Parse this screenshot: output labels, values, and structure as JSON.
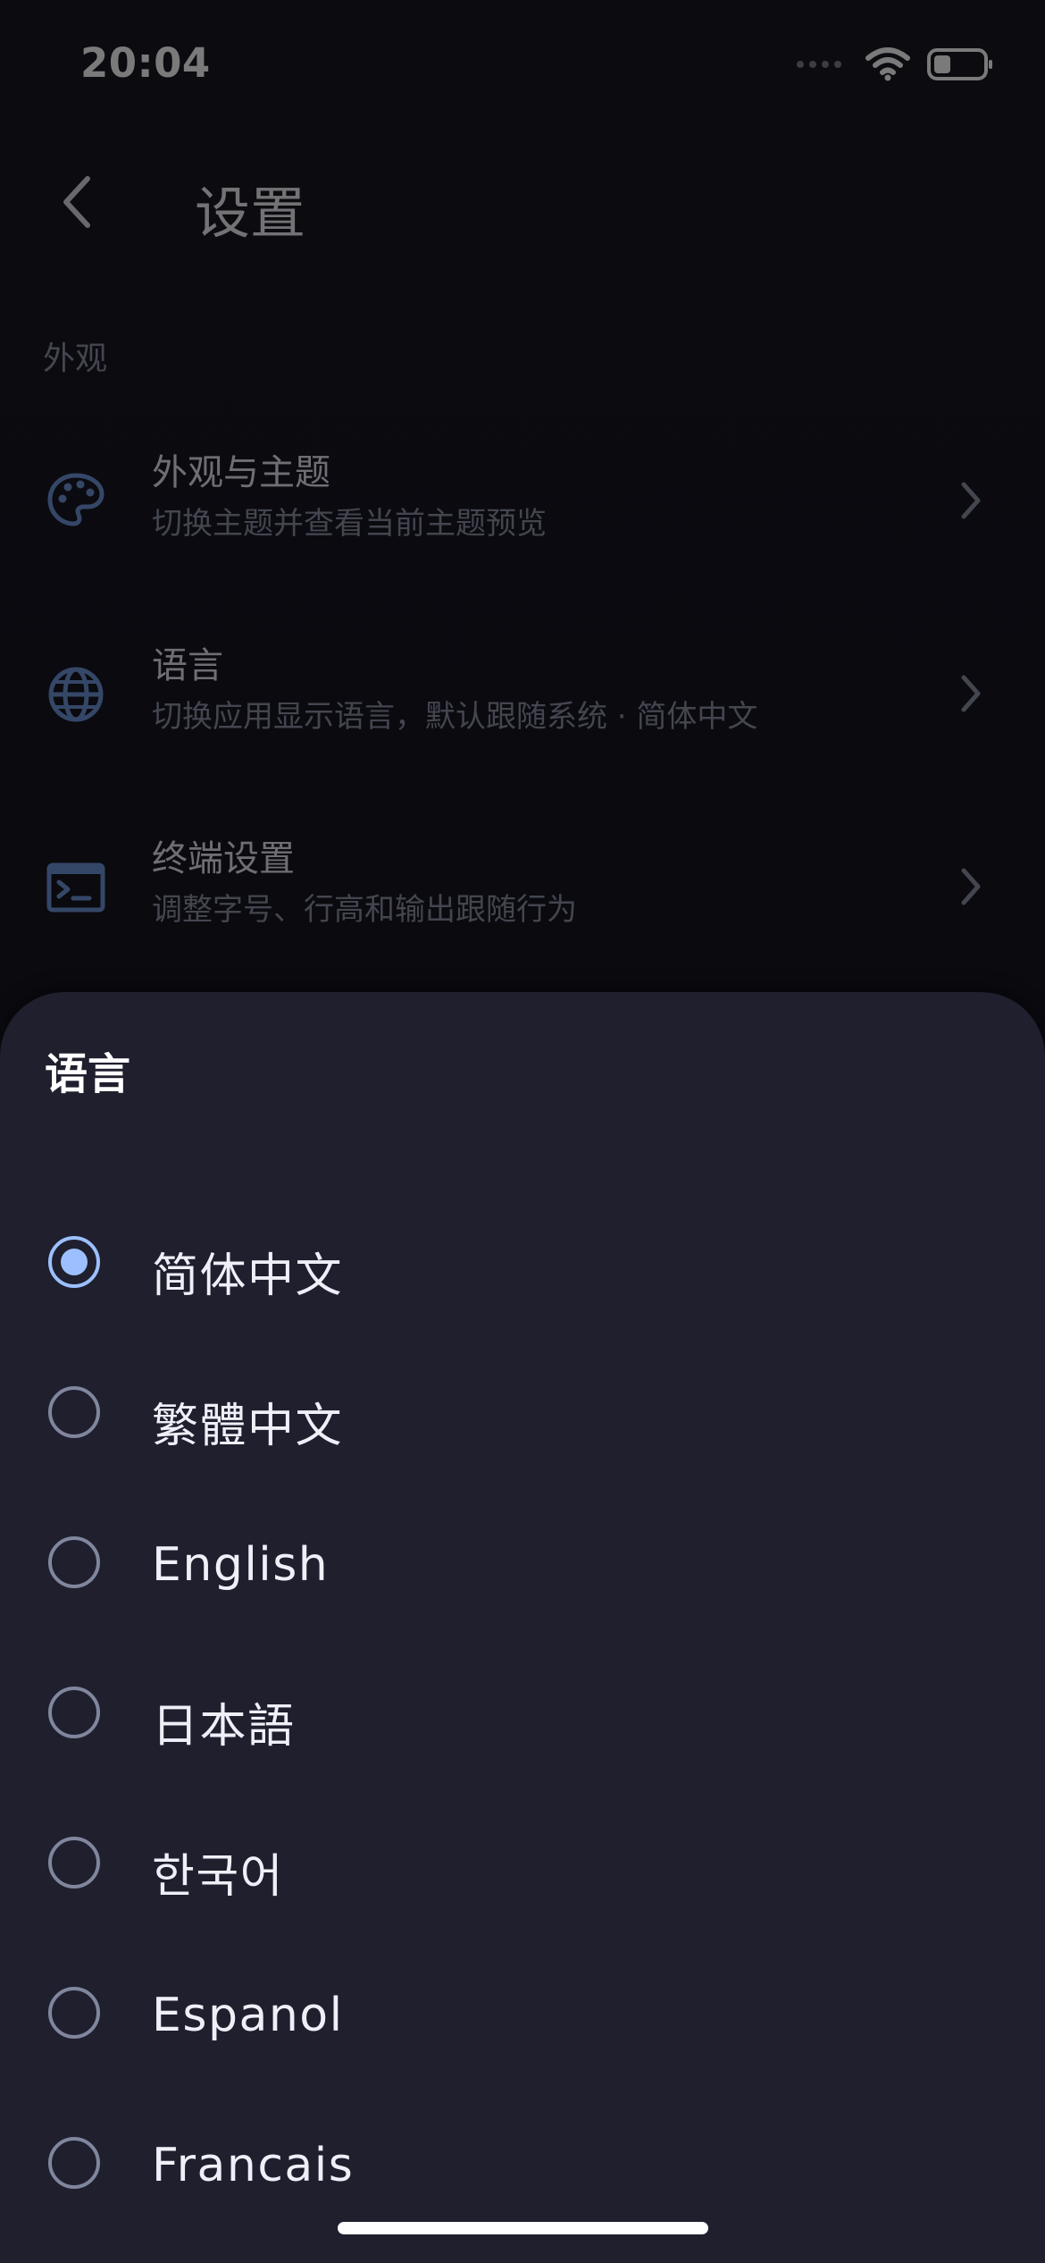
{
  "status_bar": {
    "time": "20:04",
    "icons": [
      "signal-dots-icon",
      "wifi-icon",
      "battery-icon"
    ]
  },
  "header": {
    "title": "设置",
    "back_icon": "chevron-left-icon"
  },
  "section": {
    "label": "外观"
  },
  "settings": [
    {
      "title": "外观与主题",
      "subtitle": "切换主题并查看当前主题预览",
      "icon": "palette-icon"
    },
    {
      "title": "语言",
      "subtitle": "切换应用显示语言，默认跟随系统 · 简体中文",
      "icon": "globe-icon"
    },
    {
      "title": "终端设置",
      "subtitle": "调整字号、行高和输出跟随行为",
      "icon": "terminal-icon"
    }
  ],
  "sheet": {
    "title": "语言",
    "options": [
      {
        "label": "简体中文",
        "selected": true
      },
      {
        "label": "繁體中文",
        "selected": false
      },
      {
        "label": "English",
        "selected": false
      },
      {
        "label": "日本語",
        "selected": false
      },
      {
        "label": "한국어",
        "selected": false
      },
      {
        "label": "Espanol",
        "selected": false
      },
      {
        "label": "Francais",
        "selected": false
      }
    ]
  },
  "colors": {
    "accent": "#9cc0ff",
    "sheet_bg": "#1f1f2e",
    "icon_blue": "#6f95d8"
  }
}
